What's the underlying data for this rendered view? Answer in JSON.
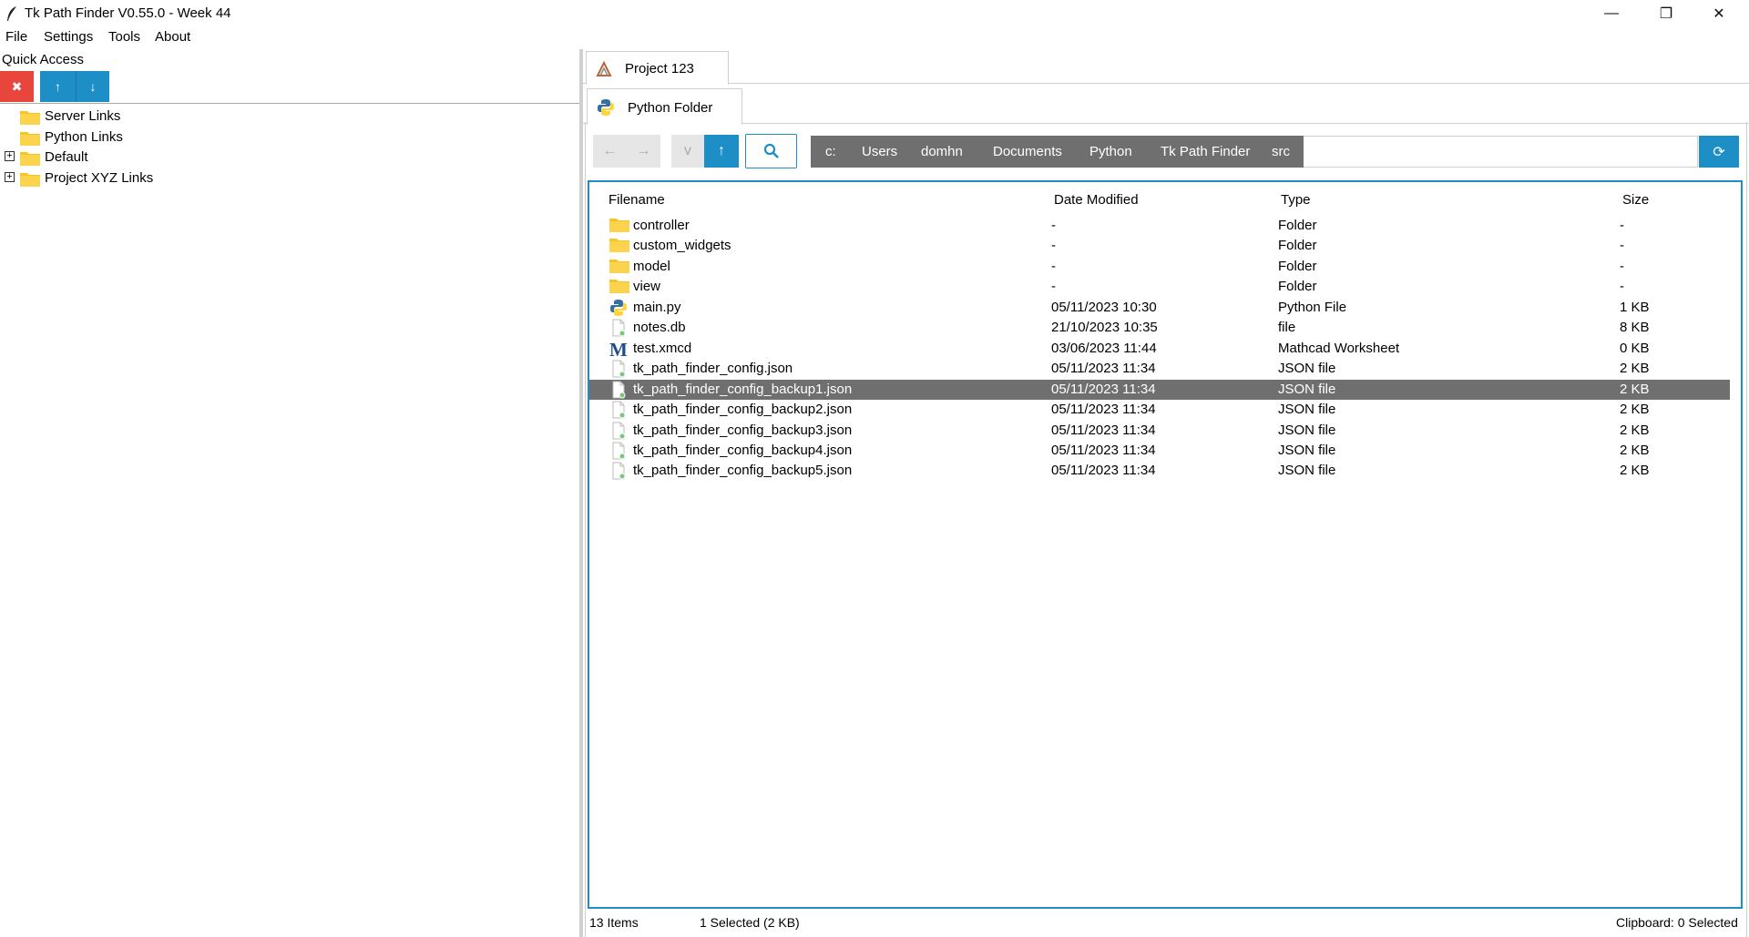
{
  "window": {
    "title": "Tk Path Finder V0.55.0 - Week 44",
    "min_glyph": "—",
    "max_glyph": "❐",
    "close_glyph": "✕"
  },
  "menu": [
    "File",
    "Settings",
    "Tools",
    "About"
  ],
  "quick_access": {
    "label": "Quick Access",
    "delete_glyph": "✖",
    "up_glyph": "↑",
    "down_glyph": "↓",
    "items": [
      {
        "label": "Server Links",
        "expandable": false
      },
      {
        "label": "Python Links",
        "expandable": false
      },
      {
        "label": "Default",
        "expandable": true,
        "expander": "+"
      },
      {
        "label": "Project XYZ Links",
        "expandable": true,
        "expander": "+"
      }
    ]
  },
  "tabs": {
    "project": "Project 123",
    "folder": "Python Folder"
  },
  "toolbar": {
    "back_glyph": "←",
    "forward_glyph": "→",
    "history_glyph": "v",
    "up_glyph": "↑",
    "refresh_glyph": "⟳"
  },
  "breadcrumb": [
    "c:",
    "Users",
    "domhn",
    "Documents",
    "Python",
    "Tk Path Finder",
    "src"
  ],
  "columns": {
    "filename": "Filename",
    "date": "Date Modified",
    "type": "Type",
    "size": "Size"
  },
  "files": [
    {
      "name": "controller",
      "date": "-",
      "type": "Folder",
      "size": "-",
      "icon": "folder-icon"
    },
    {
      "name": "custom_widgets",
      "date": "-",
      "type": "Folder",
      "size": "-",
      "icon": "folder-icon"
    },
    {
      "name": "model",
      "date": "-",
      "type": "Folder",
      "size": "-",
      "icon": "folder-icon"
    },
    {
      "name": "view",
      "date": "-",
      "type": "Folder",
      "size": "-",
      "icon": "folder-icon"
    },
    {
      "name": "main.py",
      "date": "05/11/2023  10:30",
      "type": "Python File",
      "size": "1 KB",
      "icon": "python-icon"
    },
    {
      "name": "notes.db",
      "date": "21/10/2023  10:35",
      "type": "file",
      "size": "8 KB",
      "icon": "file-icon"
    },
    {
      "name": "test.xmcd",
      "date": "03/06/2023  11:44",
      "type": "Mathcad Worksheet",
      "size": "0 KB",
      "icon": "mathcad-icon"
    },
    {
      "name": "tk_path_finder_config.json",
      "date": "05/11/2023  11:34",
      "type": "JSON file",
      "size": "2 KB",
      "icon": "file-icon"
    },
    {
      "name": "tk_path_finder_config_backup1.json",
      "date": "05/11/2023  11:34",
      "type": "JSON file",
      "size": "2 KB",
      "icon": "file-icon",
      "selected": true
    },
    {
      "name": "tk_path_finder_config_backup2.json",
      "date": "05/11/2023  11:34",
      "type": "JSON file",
      "size": "2 KB",
      "icon": "file-icon"
    },
    {
      "name": "tk_path_finder_config_backup3.json",
      "date": "05/11/2023  11:34",
      "type": "JSON file",
      "size": "2 KB",
      "icon": "file-icon"
    },
    {
      "name": "tk_path_finder_config_backup4.json",
      "date": "05/11/2023  11:34",
      "type": "JSON file",
      "size": "2 KB",
      "icon": "file-icon"
    },
    {
      "name": "tk_path_finder_config_backup5.json",
      "date": "05/11/2023  11:34",
      "type": "JSON file",
      "size": "2 KB",
      "icon": "file-icon"
    }
  ],
  "status": {
    "items": "13 Items",
    "selected": "1 Selected  (2 KB)",
    "clipboard": "Clipboard: 0 Selected"
  },
  "colors": {
    "accent": "#1e8ec6",
    "delete": "#e8453c",
    "selection": "#6f6f6f",
    "folder": "#f7c325"
  }
}
